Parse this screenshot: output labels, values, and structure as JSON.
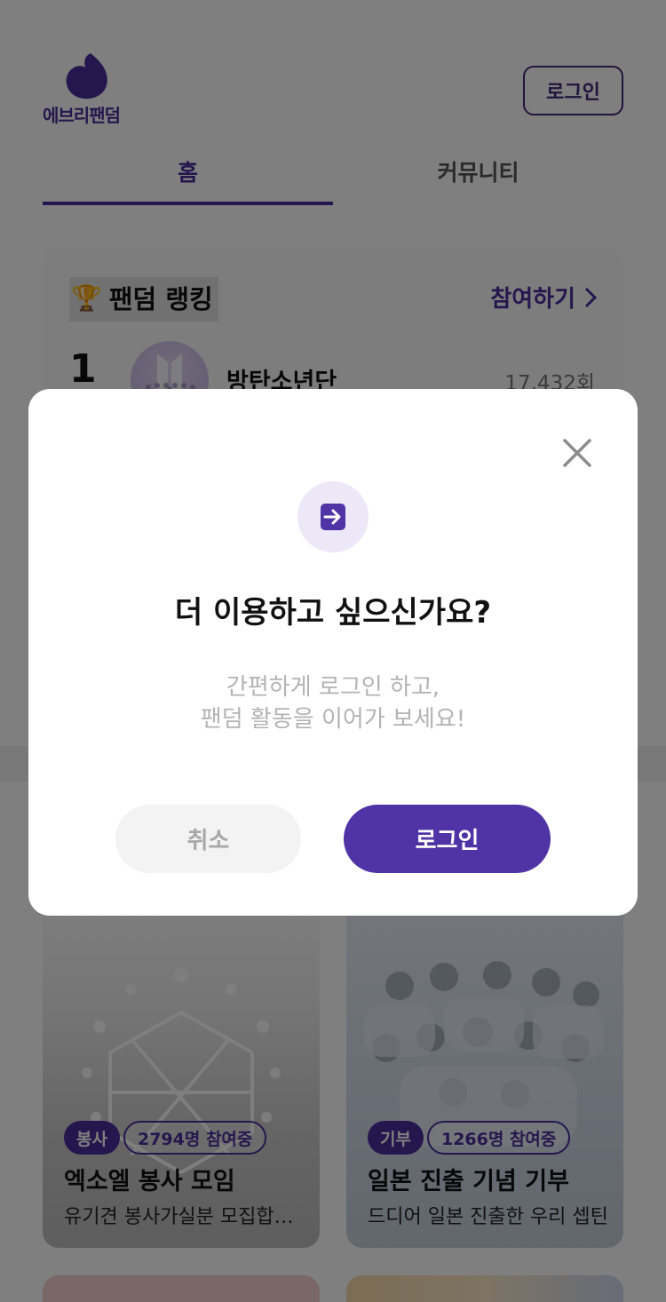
{
  "brand": {
    "name": "에브리팬덤",
    "color": "#4a2f9c"
  },
  "header": {
    "login_label": "로그인"
  },
  "tabs": [
    {
      "label": "홈",
      "active": true
    },
    {
      "label": "커뮤니티",
      "active": false
    }
  ],
  "ranking": {
    "title": "팬덤 랭킹",
    "join_label": "참여하기",
    "items": [
      {
        "rank": "1",
        "name": "방탄소년단",
        "count": "17,432회"
      }
    ]
  },
  "events": [
    {
      "category": "봉사",
      "participants": "2794명 참여중",
      "title": "엑소엘 봉사 모임",
      "description": "유기견 봉사가실분 모집합니다"
    },
    {
      "category": "기부",
      "participants": "1266명 참여중",
      "title": "일본 진출 기념 기부",
      "description": "드디어 일본 진출한 우리 셉틴"
    }
  ],
  "modal": {
    "title": "더 이용하고 싶으신가요?",
    "description_line1": "간편하게 로그인 하고,",
    "description_line2": "팬덤 활동을 이어가 보세요!",
    "cancel_label": "취소",
    "login_label": "로그인",
    "icon": "login-arrow-icon",
    "accent": "#5034a6"
  }
}
